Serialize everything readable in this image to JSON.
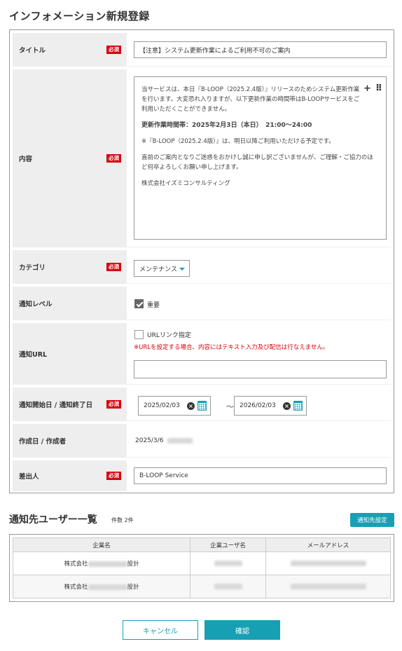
{
  "page": {
    "title": "インフォメーション新規登録"
  },
  "form": {
    "required_badge": "必須",
    "title": {
      "label": "タイトル",
      "value": "【注意】システム更新作業によるご利用不可のご案内"
    },
    "content": {
      "label": "内容",
      "tool_plus": "+",
      "tool_drag": "⠿",
      "paragraphs": [
        "当サービスは、本日『B-LOOP（2025.2.4版）』リリースのためシステム更新作業を行います。大変恐れ入りますが、以下更新作業の時間帯はB-LOOPサービスをご利用いただくことができません。",
        "更新作業時間帯：2025年2月3日（本日）　21:00～24:00",
        "※『B-LOOP（2025.2.4版）』は、明日以降ご利用いただける予定です。",
        "直前のご案内となりご迷惑をおかけし誠に申し訳ございませんが、ご理解・ご協力のほど何卒よろしくお願い申し上げます。",
        "株式会社イズミコンサルティング"
      ]
    },
    "category": {
      "label": "カテゴリ",
      "value": "メンテナンス"
    },
    "level": {
      "label": "通知レベル",
      "checkbox_label": "重要",
      "checked": true
    },
    "url": {
      "label": "通知URL",
      "checkbox_label": "URLリンク指定",
      "checked": false,
      "warning": "※URLを設定する場合、内容にはテキスト入力及び配信は行なえません。",
      "value": ""
    },
    "period": {
      "label": "通知開始日 / 通知終了日",
      "start": "2025/02/03",
      "separator": "～",
      "end": "2026/02/03"
    },
    "created": {
      "label": "作成日 / 作成者",
      "value": "2025/3/6"
    },
    "sender": {
      "label": "差出人",
      "value": "B-LOOP Service"
    }
  },
  "recipients": {
    "title": "通知先ユーザー一覧",
    "count": "件数 2件",
    "settings_button": "通知先設定",
    "columns": [
      "企業名",
      "企業ユーザ名",
      "メールアドレス"
    ],
    "rows": [
      {
        "company_prefix": "株式会社",
        "company_suffix": "設計"
      },
      {
        "company_prefix": "株式会社",
        "company_suffix": "設計"
      }
    ]
  },
  "actions": {
    "cancel": "キャンセル",
    "confirm": "確認"
  },
  "colors": {
    "accent": "#17a0b3",
    "required": "#d9000d",
    "label_bg": "#eeeeee"
  }
}
